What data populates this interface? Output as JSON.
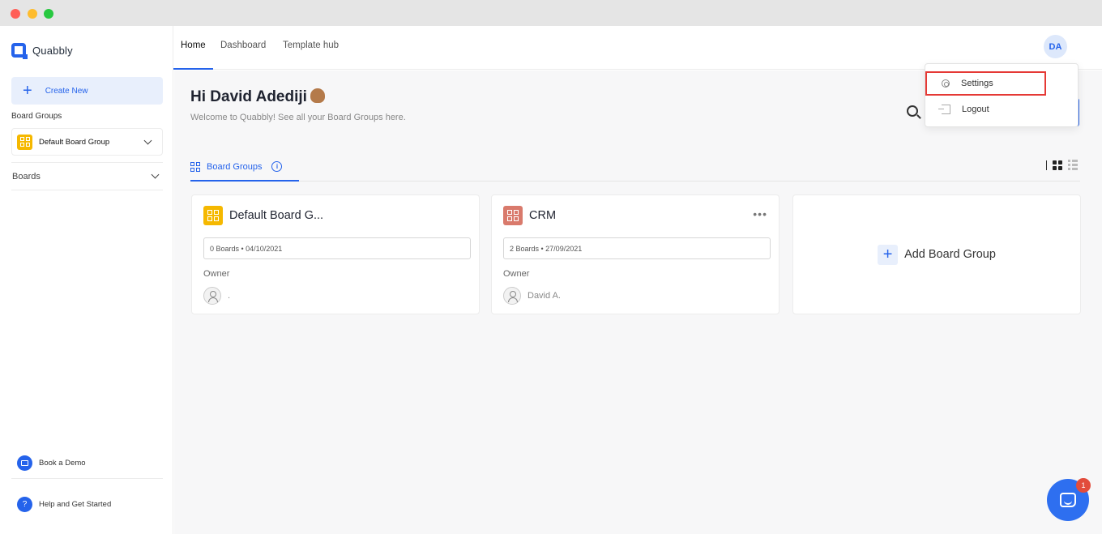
{
  "app": {
    "name": "Quabbly"
  },
  "sidebar": {
    "create_new_label": "Create New",
    "board_groups_heading": "Board Groups",
    "selected_board_group": "Default Board Group",
    "boards_label": "Boards",
    "book_demo_label": "Book a Demo",
    "help_label": "Help and Get Started",
    "help_icon_text": "?"
  },
  "topnav": {
    "tabs": [
      {
        "label": "Home",
        "active": true
      },
      {
        "label": "Dashboard",
        "active": false
      },
      {
        "label": "Template hub",
        "active": false
      }
    ],
    "avatar_initials": "DA"
  },
  "main": {
    "greeting": "Hi David Adediji",
    "welcome": "Welcome to Quabbly! See all your Board Groups here.",
    "section_tab_label": "Board Groups",
    "info_icon_text": "i",
    "cards": [
      {
        "title": "Default Board G...",
        "meta": "0 Boards • 04/10/2021",
        "owner_label": "Owner",
        "owner_name": ".",
        "icon_color": "#f5b800"
      },
      {
        "title": "CRM",
        "meta": "2 Boards • 27/09/2021",
        "owner_label": "Owner",
        "owner_name": "David A.",
        "icon_color": "#d97a6c"
      }
    ],
    "add_card_label": "Add Board Group",
    "add_card_icon": "+"
  },
  "dropdown": {
    "items": [
      {
        "label": "Settings",
        "icon": "gear-icon"
      },
      {
        "label": "Logout",
        "icon": "logout-icon"
      }
    ]
  },
  "chat": {
    "badge_count": "1"
  },
  "colors": {
    "accent": "#2563eb",
    "highlight": "#e53935"
  }
}
